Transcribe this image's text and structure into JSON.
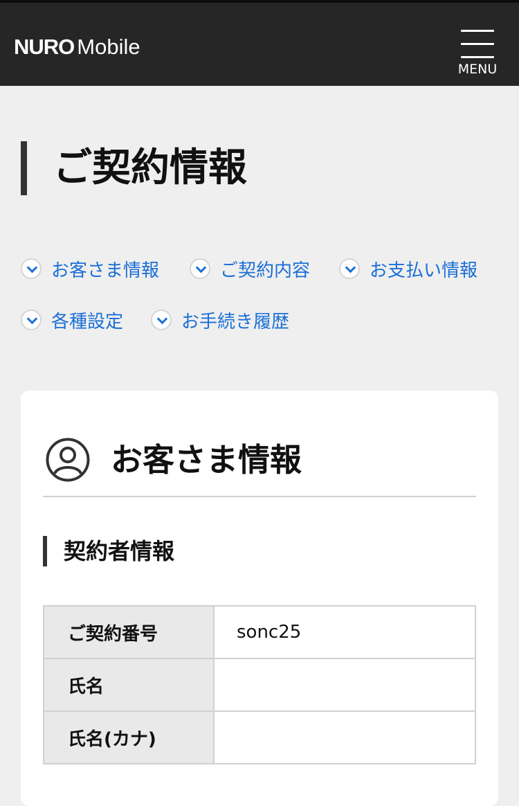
{
  "header": {
    "logo_bold": "NURO",
    "logo_light": "Mobile",
    "menu_label": "MENU"
  },
  "page": {
    "title": "ご契約情報"
  },
  "anchors": [
    {
      "label": "お客さま情報"
    },
    {
      "label": "ご契約内容"
    },
    {
      "label": "お支払い情報"
    },
    {
      "label": "各種設定"
    },
    {
      "label": "お手続き履歴"
    }
  ],
  "card": {
    "title": "お客さま情報",
    "icon": "user-circle-icon",
    "section_title": "契約者情報",
    "rows": [
      {
        "label": "ご契約番号",
        "value": "sonc25"
      },
      {
        "label": "氏名",
        "value": ""
      },
      {
        "label": "氏名(カナ)",
        "value": ""
      }
    ]
  },
  "colors": {
    "header_bg": "#262626",
    "page_bg": "#efefef",
    "link": "#1a6fd6",
    "accent_bar": "#333333"
  }
}
